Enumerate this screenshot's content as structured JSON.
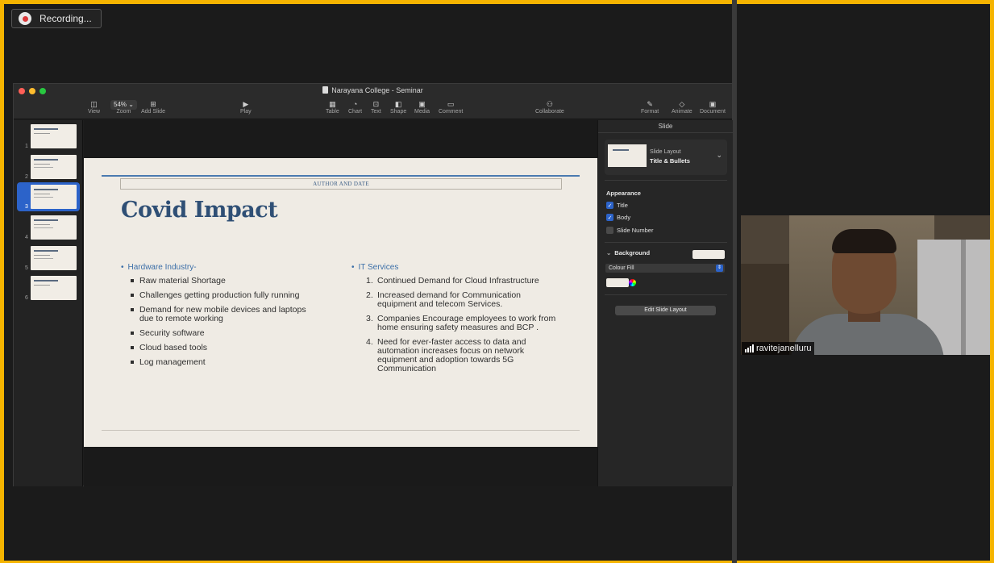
{
  "recording": {
    "label": "Recording...",
    "icon": "cloud-record-icon"
  },
  "window": {
    "title": "Narayana College - Seminar"
  },
  "toolbar": {
    "view": "View",
    "zoom_value": "54%",
    "zoom": "Zoom",
    "add_slide": "Add Slide",
    "play": "Play",
    "table": "Table",
    "chart": "Chart",
    "text": "Text",
    "shape": "Shape",
    "media": "Media",
    "comment": "Comment",
    "collaborate": "Collaborate",
    "format": "Format",
    "animate": "Animate",
    "document": "Document"
  },
  "navigator": {
    "slides": [
      {
        "num": "1"
      },
      {
        "num": "2"
      },
      {
        "num": "3",
        "active": true
      },
      {
        "num": "4"
      },
      {
        "num": "5"
      },
      {
        "num": "6"
      }
    ]
  },
  "slide": {
    "author": "AUTHOR AND DATE",
    "title": "Covid Impact",
    "left_heading": "Hardware Industry-",
    "left_items": [
      "Raw material Shortage",
      "Challenges getting production fully running",
      "Demand for new mobile devices and laptops due to remote working",
      "Security software",
      "Cloud based tools",
      "Log management"
    ],
    "right_heading": "IT Services",
    "right_items": [
      {
        "n": "1.",
        "text": "Continued Demand for Cloud Infrastructure"
      },
      {
        "n": "2.",
        "text": "Increased demand for Communication equipment and telecom Services."
      },
      {
        "n": "3.",
        "text": "Companies Encourage employees to work from home ensuring safety measures and BCP ."
      },
      {
        "n": "4.",
        "text": "Need for ever-faster access to data and automation increases focus on network equipment and adoption towards 5G Communication"
      }
    ]
  },
  "inspector": {
    "tab": "Slide",
    "layout_label": "Slide Layout",
    "layout_name": "Title & Bullets",
    "appearance": "Appearance",
    "title_cb": "Title",
    "body_cb": "Body",
    "slide_number_cb": "Slide Number",
    "background": "Background",
    "fill_type": "Colour Fill",
    "edit_layout": "Edit Slide Layout"
  },
  "participant": {
    "name": "ravitejanelluru"
  },
  "colors": {
    "accent": "#2c63c9",
    "frame": "#f5b400",
    "title": "#2f4f75"
  }
}
